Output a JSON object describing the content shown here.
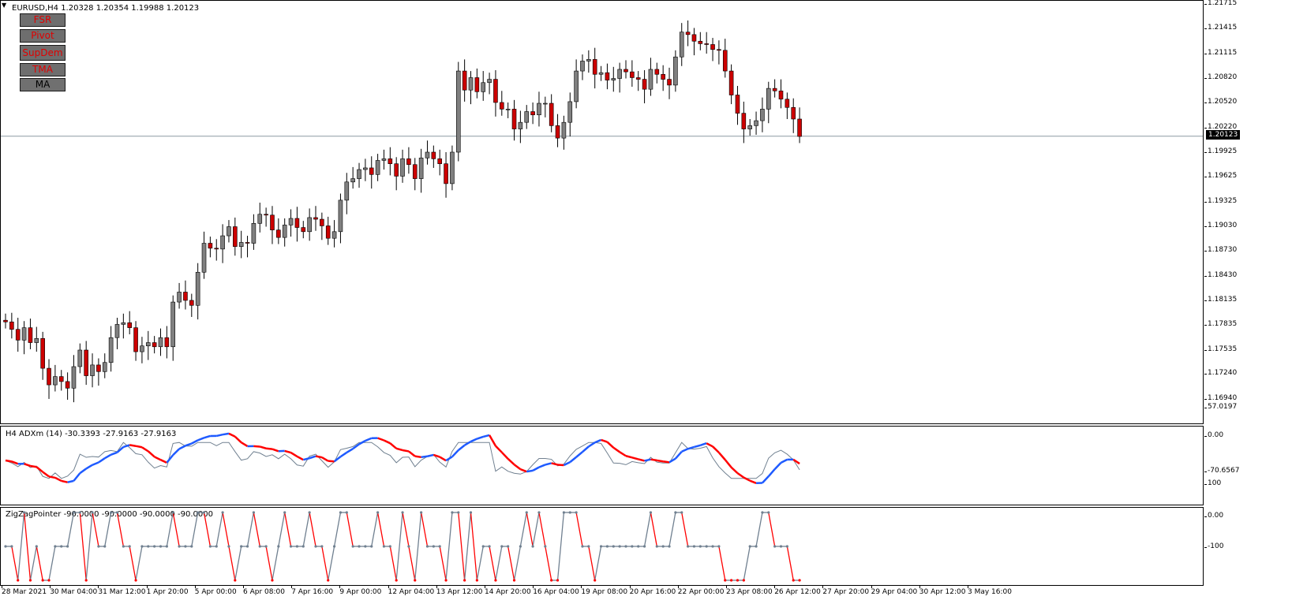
{
  "symbol_info": "EURUSD,H4  1.20328 1.20354 1.19988 1.20123",
  "buttons": [
    {
      "label": "FSR",
      "active": false
    },
    {
      "label": "Pivot",
      "active": false
    },
    {
      "label": "SupDem",
      "active": false
    },
    {
      "label": "TMA",
      "active": false
    },
    {
      "label": "MA",
      "active": true
    }
  ],
  "current_price": "1.20123",
  "price_ticks": [
    "1.21715",
    "1.21415",
    "1.21115",
    "1.20820",
    "1.20520",
    "1.20220",
    "1.19925",
    "1.19625",
    "1.19325",
    "1.19030",
    "1.18730",
    "1.18430",
    "1.18135",
    "1.17835",
    "1.17535",
    "1.17240",
    "1.16940"
  ],
  "adx": {
    "label": "H4 ADXm (14) -30.3393 -27.9163 -27.9163",
    "ticks": [
      "57.0197",
      "0.00",
      "-70.6567"
    ]
  },
  "zigzag": {
    "label": "ZigZagPointer -90.0000 -90.0000 -90.0000 -90.0000",
    "ticks": [
      "100",
      "0.00",
      "-100"
    ]
  },
  "time_labels": [
    "28 Mar 2021",
    "30 Mar 04:00",
    "31 Mar 12:00",
    "1 Apr 20:00",
    "5 Apr 00:00",
    "6 Apr 08:00",
    "7 Apr 16:00",
    "9 Apr 00:00",
    "12 Apr 04:00",
    "13 Apr 12:00",
    "14 Apr 20:00",
    "16 Apr 04:00",
    "19 Apr 08:00",
    "20 Apr 16:00",
    "22 Apr 00:00",
    "23 Apr 08:00",
    "26 Apr 12:00",
    "27 Apr 20:00",
    "29 Apr 04:00",
    "30 Apr 12:00",
    "3 May 16:00"
  ],
  "colors": {
    "bull": "#808080",
    "bear": "#cc0000",
    "adx_up": "#1e5aff",
    "adx_down": "#ff0000",
    "zz_up": "#708090",
    "zz_down": "#ff0000"
  },
  "chart_data": {
    "type": "candlestick",
    "ylim": [
      1.1694,
      1.2172
    ],
    "close": [
      1.1788,
      1.1779,
      1.1766,
      1.1781,
      1.1763,
      1.1768,
      1.1732,
      1.1712,
      1.1722,
      1.1716,
      1.1708,
      1.1734,
      1.1754,
      1.1723,
      1.1736,
      1.1728,
      1.1739,
      1.1769,
      1.1785,
      1.1787,
      1.1781,
      1.1752,
      1.1759,
      1.1763,
      1.1758,
      1.1769,
      1.1758,
      1.1812,
      1.1824,
      1.1814,
      1.1808,
      1.1848,
      1.1883,
      1.1877,
      1.1876,
      1.1892,
      1.1903,
      1.1879,
      1.1884,
      1.1883,
      1.1907,
      1.1918,
      1.1917,
      1.1899,
      1.189,
      1.1905,
      1.1913,
      1.1902,
      1.1897,
      1.1914,
      1.1912,
      1.1904,
      1.1889,
      1.1897,
      1.1935,
      1.1957,
      1.1961,
      1.1972,
      1.1974,
      1.1966,
      1.1983,
      1.1985,
      1.1979,
      1.1964,
      1.1985,
      1.1978,
      1.1961,
      1.1986,
      1.1993,
      1.1985,
      1.1979,
      1.1955,
      1.1993,
      1.2091,
      1.2068,
      1.2083,
      1.2066,
      1.2077,
      1.2081,
      1.2053,
      1.2045,
      1.2045,
      1.2021,
      1.2029,
      1.2042,
      1.2038,
      1.2052,
      1.2052,
      1.2025,
      1.201,
      1.2029,
      1.2054,
      1.2091,
      1.2103,
      1.2105,
      1.2087,
      1.2089,
      1.208,
      1.2082,
      1.2093,
      1.209,
      1.2083,
      1.2081,
      1.2069,
      1.2093,
      1.2087,
      1.2081,
      1.2074,
      1.2108,
      1.2138,
      1.2135,
      1.2127,
      1.2124,
      1.2123,
      1.2117,
      1.2116,
      1.2091,
      1.2062,
      1.204,
      1.2021,
      1.2025,
      1.2031,
      1.2045,
      1.207,
      1.2067,
      1.2057,
      1.2047,
      1.2033,
      1.2012
    ],
    "open": [
      1.179,
      1.1788,
      1.1779,
      1.1766,
      1.1781,
      1.1763,
      1.1768,
      1.1732,
      1.1712,
      1.1722,
      1.1716,
      1.1708,
      1.1734,
      1.1754,
      1.1723,
      1.1736,
      1.1728,
      1.1739,
      1.1769,
      1.1785,
      1.1787,
      1.1781,
      1.1752,
      1.1759,
      1.1763,
      1.1758,
      1.1769,
      1.1758,
      1.1812,
      1.1824,
      1.1814,
      1.1808,
      1.1848,
      1.1883,
      1.1877,
      1.1876,
      1.1892,
      1.1903,
      1.1879,
      1.1884,
      1.1883,
      1.1907,
      1.1918,
      1.1917,
      1.1899,
      1.189,
      1.1905,
      1.1913,
      1.1902,
      1.1897,
      1.1914,
      1.1912,
      1.1904,
      1.1889,
      1.1897,
      1.1935,
      1.1957,
      1.1961,
      1.1972,
      1.1974,
      1.1966,
      1.1983,
      1.1985,
      1.1979,
      1.1964,
      1.1985,
      1.1978,
      1.1961,
      1.1986,
      1.1993,
      1.1985,
      1.1979,
      1.1955,
      1.1993,
      1.2091,
      1.2068,
      1.2083,
      1.2066,
      1.2077,
      1.2081,
      1.2053,
      1.2045,
      1.2045,
      1.2021,
      1.2029,
      1.2042,
      1.2038,
      1.2052,
      1.2052,
      1.2025,
      1.201,
      1.2029,
      1.2054,
      1.2091,
      1.2103,
      1.2105,
      1.2087,
      1.2089,
      1.208,
      1.2082,
      1.2093,
      1.209,
      1.2083,
      1.2081,
      1.2069,
      1.2093,
      1.2087,
      1.2081,
      1.2074,
      1.2108,
      1.2138,
      1.2135,
      1.2127,
      1.2124,
      1.2123,
      1.2117,
      1.2116,
      1.2091,
      1.2062,
      1.204,
      1.2021,
      1.2025,
      1.2031,
      1.2045,
      1.207,
      1.2067,
      1.2057,
      1.2047,
      1.2033
    ]
  }
}
